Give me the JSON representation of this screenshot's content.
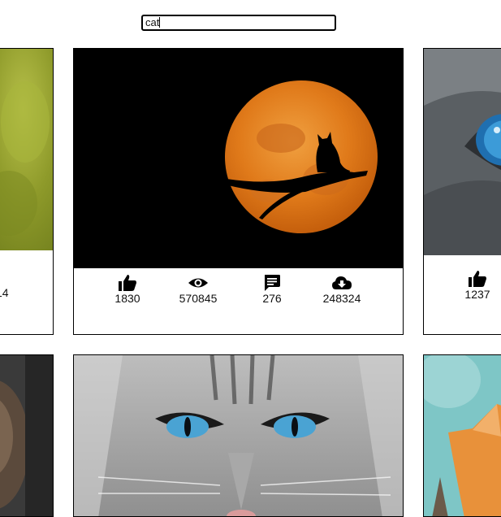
{
  "search": {
    "value": "cat"
  },
  "cards": {
    "top_left": {
      "stat_partial": "14"
    },
    "top_middle": {
      "likes": "1830",
      "views": "570845",
      "comments": "276",
      "downloads": "248324"
    },
    "top_right": {
      "likes": "1237"
    }
  },
  "icons": [
    "thumbs-up-icon",
    "eye-icon",
    "comment-icon",
    "cloud-download-icon"
  ],
  "colors": {
    "moon": "#e07a1a",
    "border": "#000000"
  }
}
